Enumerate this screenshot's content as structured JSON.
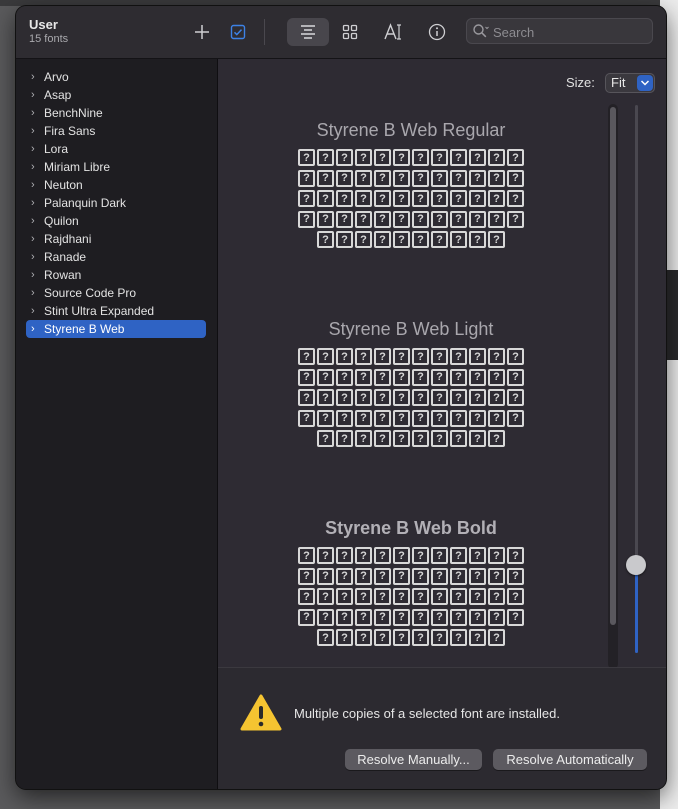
{
  "collection": {
    "name": "User",
    "count": "15 fonts"
  },
  "toolbar": {
    "add_icon": "plus-icon",
    "enable_icon": "checkbox-icon",
    "views": [
      "sample-view-icon",
      "grid-view-icon",
      "info-text-icon",
      "info-icon"
    ],
    "search_placeholder": "Search"
  },
  "fonts": [
    "Arvo",
    "Asap",
    "BenchNine",
    "Fira Sans",
    "Lora",
    "Miriam Libre",
    "Neuton",
    "Palanquin Dark",
    "Quilon",
    "Rajdhani",
    "Ranade",
    "Rowan",
    "Source Code Pro",
    "Stint Ultra Expanded",
    "Styrene B Web"
  ],
  "selected_font": "Styrene B Web",
  "size": {
    "label": "Size:",
    "value": "Fit"
  },
  "faces": [
    {
      "name": "Styrene B Web Regular",
      "style": "regular"
    },
    {
      "name": "Styrene B Web Light",
      "style": "light"
    },
    {
      "name": "Styrene B Web Bold",
      "style": "bold"
    }
  ],
  "glyph_rows": [
    12,
    12,
    12,
    12,
    10
  ],
  "alert": {
    "message": "Multiple copies of a selected font are installed.",
    "resolve_manual": "Resolve Manually...",
    "resolve_auto": "Resolve Automatically"
  },
  "colors": {
    "accent": "#2f63c4",
    "warning": "#f5c431"
  }
}
